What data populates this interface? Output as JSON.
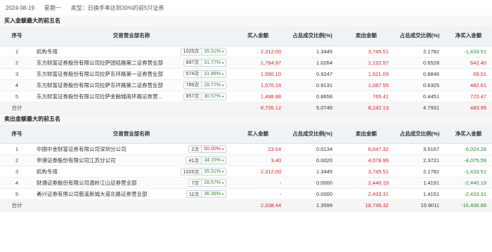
{
  "header": {
    "date": "2024-08-19",
    "weekday": "星期一",
    "type": "类型：日换手率达到30%的前5只证券"
  },
  "columns": [
    "序号",
    "交易营业部名称",
    "买入金额",
    "占总成交比例(%)",
    "卖出金额",
    "占总成交比例(%)",
    "净买入金额"
  ],
  "buy": {
    "title": "买入金额最大的前五名",
    "rows": [
      {
        "idx": "1",
        "name": "机构专用",
        "count": "1025次",
        "pct": "35.51%",
        "buy": "2,312.00",
        "buy_ratio": "1.3445",
        "sell": "3,745.51",
        "sell_ratio": "2.1782",
        "net": "-1,433.51"
      },
      {
        "idx": "2",
        "name": "东方财富证券股份有限公司拉萨团结路第二证券营业部",
        "count": "897次",
        "pct": "31.77%",
        "buy": "1,764.97",
        "buy_ratio": "1.0264",
        "sell": "1,122.57",
        "sell_ratio": "0.6528",
        "net": "642.40"
      },
      {
        "idx": "3",
        "name": "东方财富证券股份有限公司拉萨东环路第一证券营业部",
        "count": "574次",
        "pct": "31.88%",
        "buy": "1,590.10",
        "buy_ratio": "0.9247",
        "sell": "1,521.09",
        "sell_ratio": "0.8846",
        "net": "69.01"
      },
      {
        "idx": "4",
        "name": "东方财富证券股份有限公司拉萨东环路第二证券营业部",
        "count": "789次",
        "pct": "28.77%",
        "buy": "1,570.16",
        "buy_ratio": "0.9131",
        "sell": "1,087.55",
        "sell_ratio": "0.6325",
        "net": "482.61"
      },
      {
        "idx": "5",
        "name": "东方财富证券股份有限公司拉萨金融城南环路证券营...",
        "count": "857次",
        "pct": "30.57%",
        "buy": "1,488.88",
        "buy_ratio": "0.8658",
        "sell": "765.41",
        "sell_ratio": "0.4451",
        "net": "723.47"
      }
    ],
    "total": {
      "label": "合计",
      "buy": "8,726.12",
      "buy_ratio": "5.0746",
      "sell": "8,242.13",
      "sell_ratio": "4.7931",
      "net": "483.99"
    }
  },
  "sell": {
    "title": "卖出金额最大的前五名",
    "rows": [
      {
        "idx": "1",
        "name": "中国中金财富证券有限公司深圳分公司",
        "count": "2次",
        "pct": "50.00%",
        "pct_color": "red",
        "buy": "23.04",
        "buy_ratio": "0.0134",
        "sell": "6,047.32",
        "sell_ratio": "3.5167",
        "net": "-6,024.28"
      },
      {
        "idx": "2",
        "name": "申港证券股份有限公司江苏分公司",
        "count": "41次",
        "pct": "34.15%",
        "pct_color": "green",
        "buy": "3.40",
        "buy_ratio": "0.0020",
        "sell": "4,078.99",
        "sell_ratio": "2.3721",
        "net": "-4,075.59"
      },
      {
        "idx": "3",
        "name": "机构专用",
        "count": "1025次",
        "pct": "35.51%",
        "pct_color": "green",
        "buy": "2,312.00",
        "buy_ratio": "1.3445",
        "sell": "3,745.51",
        "sell_ratio": "2.1782",
        "net": "-1,433.51"
      },
      {
        "idx": "4",
        "name": "财通证券股份有限公司温岭江山证券营业部",
        "count": "7次",
        "pct": "28.57%",
        "pct_color": "green",
        "buy": "-",
        "buy_ratio": "0.0000",
        "sell": "2,440.19",
        "sell_ratio": "1.4191",
        "net": "-2,440.19"
      },
      {
        "idx": "5",
        "name": "甬兴证券有限公司慈溪新城大道北路证券营业部",
        "count": "11次",
        "pct": "36.36%",
        "pct_color": "green",
        "buy": "-",
        "buy_ratio": "0.0000",
        "sell": "2,433.31",
        "sell_ratio": "1.4151",
        "net": "-2,433.31"
      }
    ],
    "total": {
      "label": "合计",
      "buy": "2,338.44",
      "buy_ratio": "1.3599",
      "sell": "18,745.32",
      "sell_ratio": "10.9011",
      "net": "-16,406.88"
    }
  },
  "colors": {
    "red": "#e02020",
    "green": "#2a8a2a",
    "header_bg": "#eef3f8"
  }
}
